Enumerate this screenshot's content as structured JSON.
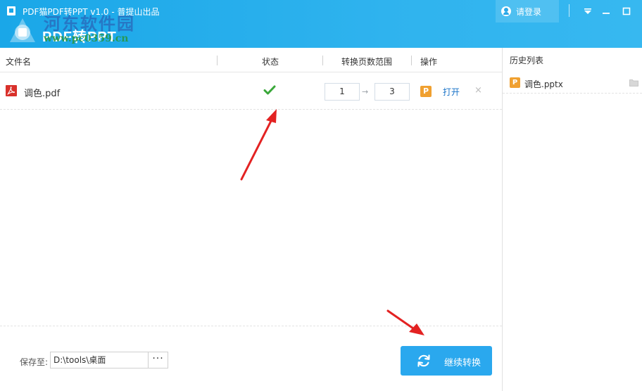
{
  "window": {
    "title": "PDF猫PDF转PPT v1.0 - 普提山出品",
    "brand": "PDF转PPT",
    "login_label": "请登录"
  },
  "watermark": {
    "name": "河东软件园",
    "url": "www.pc0359.cn"
  },
  "table": {
    "headers": {
      "filename": "文件名",
      "status": "状态",
      "page_range": "转换页数范围",
      "action": "操作"
    },
    "rows": [
      {
        "filename": "调色.pdf",
        "status": "success",
        "page_from": "1",
        "page_to": "3",
        "open_label": "打开",
        "remove_label": "×",
        "ppt_badge": "P"
      }
    ]
  },
  "bottom": {
    "save_label": "保存至:",
    "save_path": "D:\\tools\\桌面",
    "browse_label": "···",
    "continue_label": "继续转换"
  },
  "history": {
    "title": "历史列表",
    "items": [
      {
        "filename": "调色.pptx",
        "badge": "P"
      }
    ]
  },
  "colors": {
    "header_blue": "#1aa7e8",
    "button_blue": "#2aa8ee",
    "ppt_orange": "#f0a030",
    "pdf_red": "#d9312b",
    "check_green": "#3aa83a",
    "annotation_red": "#e32222"
  },
  "icons": {
    "pdf": "pdf-file-icon",
    "status": "check-icon",
    "ppt": "ppt-badge-icon",
    "login": "user-icon",
    "refresh": "refresh-icon",
    "folder": "folder-icon",
    "dropdown": "chevron-down-icon",
    "minimize": "minimize-icon",
    "maximize": "maximize-icon"
  }
}
